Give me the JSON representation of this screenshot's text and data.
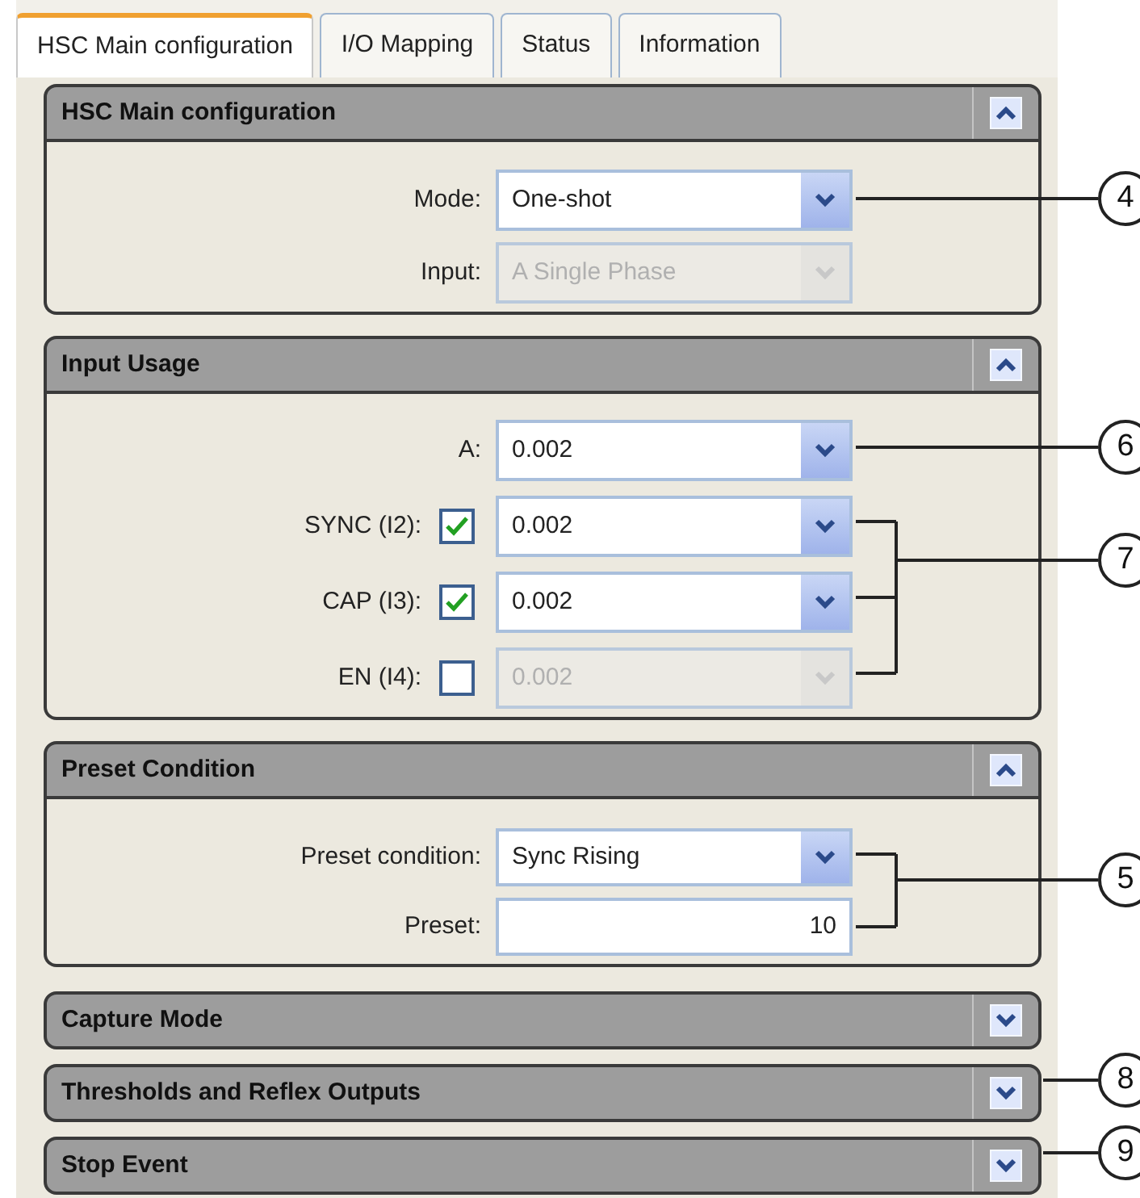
{
  "tabs": [
    {
      "label": "HSC Main configuration",
      "selected": true
    },
    {
      "label": "I/O Mapping",
      "selected": false
    },
    {
      "label": "Status",
      "selected": false
    },
    {
      "label": "Information",
      "selected": false
    }
  ],
  "sections": [
    {
      "title": "HSC Main configuration",
      "expanded": true,
      "rows": [
        {
          "kind": "select",
          "label": "Mode:",
          "value": "One-shot",
          "disabled": false
        },
        {
          "kind": "select",
          "label": "Input:",
          "value": "A Single Phase",
          "disabled": true
        }
      ]
    },
    {
      "title": "Input Usage",
      "expanded": true,
      "rows": [
        {
          "kind": "select",
          "label": "A:",
          "value": "0.002",
          "disabled": false
        },
        {
          "kind": "check_select",
          "label": "SYNC (I2):",
          "checked": true,
          "value": "0.002",
          "disabled": false
        },
        {
          "kind": "check_select",
          "label": "CAP (I3):",
          "checked": true,
          "value": "0.002",
          "disabled": false
        },
        {
          "kind": "check_select",
          "label": "EN (I4):",
          "checked": false,
          "value": "0.002",
          "disabled": true
        }
      ]
    },
    {
      "title": "Preset Condition",
      "expanded": true,
      "rows": [
        {
          "kind": "select",
          "label": "Preset condition:",
          "value": "Sync Rising",
          "disabled": false
        },
        {
          "kind": "number",
          "label": "Preset:",
          "value": "10",
          "disabled": false
        }
      ]
    },
    {
      "title": "Capture Mode",
      "expanded": false
    },
    {
      "title": "Thresholds and Reflex Outputs",
      "expanded": false
    },
    {
      "title": "Stop Event",
      "expanded": false
    }
  ],
  "callouts": [
    {
      "label": "4"
    },
    {
      "label": "6"
    },
    {
      "label": "7"
    },
    {
      "label": "5"
    },
    {
      "label": "8"
    },
    {
      "label": "9"
    }
  ]
}
